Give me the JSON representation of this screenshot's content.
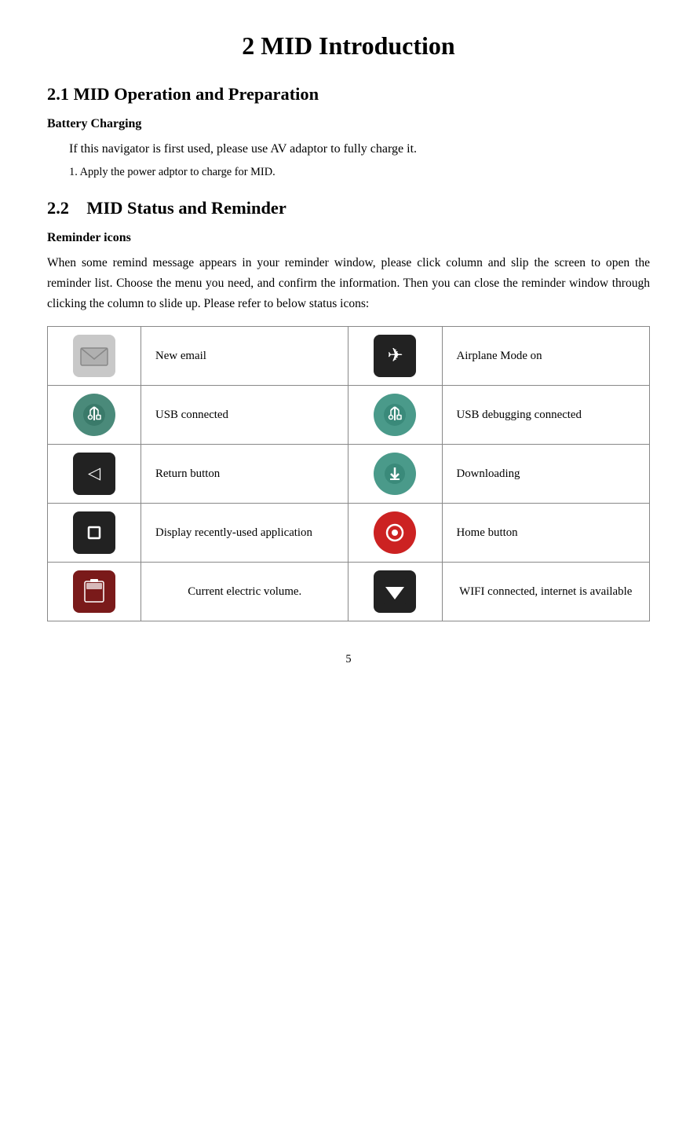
{
  "page": {
    "title": "2 MID Introduction",
    "section1": {
      "heading": "2.1 MID Operation and Preparation",
      "sub_heading": "Battery Charging",
      "para1": "If this navigator is first used, please use AV adaptor to fully charge it.",
      "para2": "1. Apply the power adptor to charge for MID."
    },
    "section2": {
      "heading": "2.2 MID Status and Reminder",
      "sub_heading": "Reminder icons",
      "body": "When some remind message appears in your reminder window, please click column and slip the screen to open the reminder list. Choose the menu you need, and confirm the information. Then you can close the reminder window through clicking the column to slide up. Please refer to below status icons:",
      "table": {
        "rows": [
          {
            "icon1_name": "new-email-icon",
            "icon1_bg": "light-gray",
            "icon1_symbol": "✉",
            "label1": "New email",
            "icon2_name": "airplane-mode-icon",
            "icon2_bg": "dark",
            "icon2_symbol": "✈",
            "label2": "Airplane Mode on"
          },
          {
            "icon1_name": "usb-connected-icon",
            "icon1_bg": "teal",
            "icon1_symbol": "⚙",
            "label1": "USB connected",
            "icon2_name": "usb-debugging-icon",
            "icon2_bg": "teal2",
            "icon2_symbol": "⚙",
            "label2": "USB debugging connected"
          },
          {
            "icon1_name": "return-button-icon",
            "icon1_bg": "dark",
            "icon1_symbol": "◁",
            "label1": "Return button",
            "icon2_name": "downloading-icon",
            "icon2_bg": "teal2",
            "icon2_symbol": "⬇",
            "label2": "Downloading"
          },
          {
            "icon1_name": "recent-apps-icon",
            "icon1_bg": "dark",
            "icon1_symbol": "▢",
            "label1": "Display      recently-used application",
            "icon2_name": "home-button-icon",
            "icon2_bg": "red-circle",
            "icon2_symbol": "◎",
            "label2": "Home button"
          },
          {
            "icon1_name": "battery-icon",
            "icon1_bg": "maroon",
            "icon1_symbol": "🔋",
            "label1": "Current electric volume.",
            "icon2_name": "wifi-icon",
            "icon2_bg": "dark-wifi",
            "icon2_symbol": "▼",
            "label2": "WIFI connected, internet is available"
          }
        ]
      }
    },
    "page_number": "5"
  }
}
